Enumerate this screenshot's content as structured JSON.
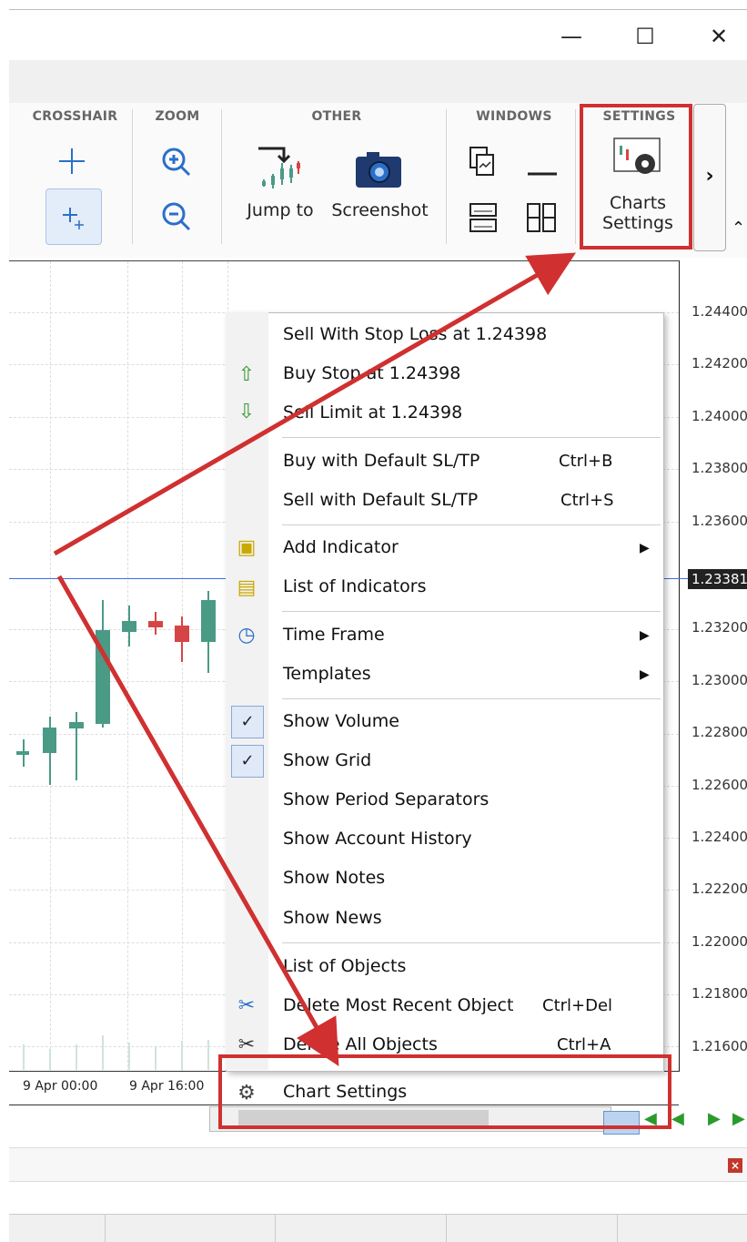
{
  "window": {
    "minimize": "—",
    "maximize": "☐",
    "close": "✕"
  },
  "ribbon": {
    "groups": {
      "crosshair": "CROSSHAIR",
      "zoom": "ZOOM",
      "other": "OTHER",
      "windows": "WINDOWS",
      "settings": "SETTINGS"
    },
    "jump_to": "Jump to",
    "screenshot": "Screenshot",
    "charts_settings_line1": "Charts",
    "charts_settings_line2": "Settings",
    "more": "›"
  },
  "chart": {
    "prices": [
      "1.24400",
      "1.24200",
      "1.24000",
      "1.23800",
      "1.23600",
      "1.23200",
      "1.23000",
      "1.22800",
      "1.22600",
      "1.22400",
      "1.22200",
      "1.22000",
      "1.21800",
      "1.21600"
    ],
    "current_price": "1.23381",
    "time_labels": [
      "9 Apr 00:00",
      "9 Apr 16:00"
    ]
  },
  "menu": {
    "sell_stop_loss": "Sell With Stop Loss at 1.24398",
    "buy_stop": "Buy Stop at 1.24398",
    "sell_limit": "Sell Limit at 1.24398",
    "buy_default": "Buy with Default SL/TP",
    "buy_default_key": "Ctrl+B",
    "sell_default": "Sell with Default SL/TP",
    "sell_default_key": "Ctrl+S",
    "add_indicator": "Add Indicator",
    "list_indicators": "List of Indicators",
    "time_frame": "Time Frame",
    "templates": "Templates",
    "show_volume": "Show Volume",
    "show_grid": "Show Grid",
    "show_period_separators": "Show Period Separators",
    "show_account_history": "Show Account History",
    "show_notes": "Show Notes",
    "show_news": "Show News",
    "list_objects": "List of Objects",
    "delete_recent": "Delete Most Recent Object",
    "delete_recent_key": "Ctrl+Del",
    "delete_all": "Delete All Objects",
    "delete_all_key": "Ctrl+A",
    "chart_settings": "Chart Settings"
  },
  "colors": {
    "annotation_red": "#d03030",
    "bull": "#4a9a86",
    "bear": "#d64545",
    "hline": "#3b6fe0"
  }
}
